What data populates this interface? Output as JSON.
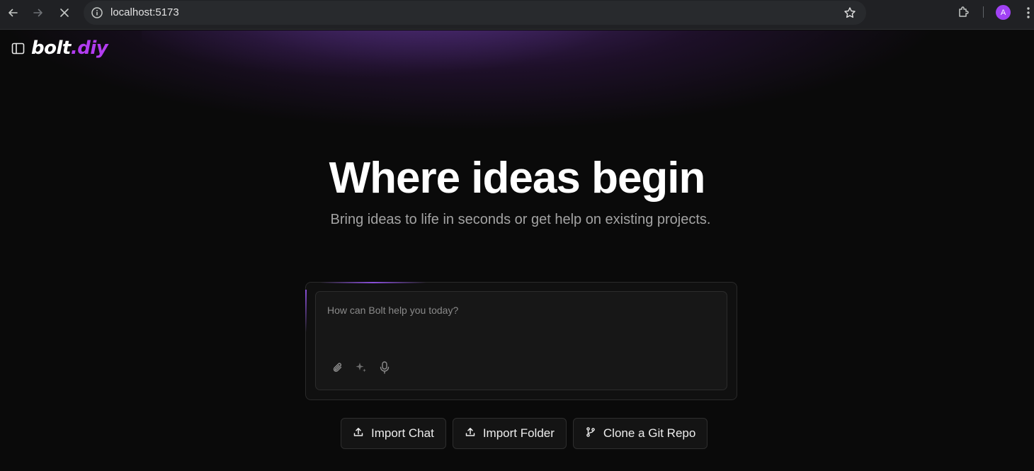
{
  "browser": {
    "url": "localhost:5173",
    "avatar_letter": "A",
    "icons": [
      "back-arrow-icon",
      "forward-arrow-icon",
      "close-icon",
      "info-icon",
      "star-icon",
      "extensions-icon",
      "kebab-menu-icon"
    ]
  },
  "header": {
    "logo_main": "bolt",
    "logo_accent": ".diy",
    "accent_color": "#b23cf0"
  },
  "hero": {
    "title": "Where ideas begin",
    "subtitle": "Bring ideas to life in seconds or get help on existing projects."
  },
  "chat": {
    "placeholder": "How can Bolt help you today?",
    "tools": [
      "paperclip-icon",
      "sparkle-icon",
      "microphone-icon"
    ]
  },
  "actions": [
    {
      "label": "Import Chat",
      "icon": "upload-icon"
    },
    {
      "label": "Import Folder",
      "icon": "upload-icon"
    },
    {
      "label": "Clone a Git Repo",
      "icon": "git-branch-icon"
    }
  ]
}
